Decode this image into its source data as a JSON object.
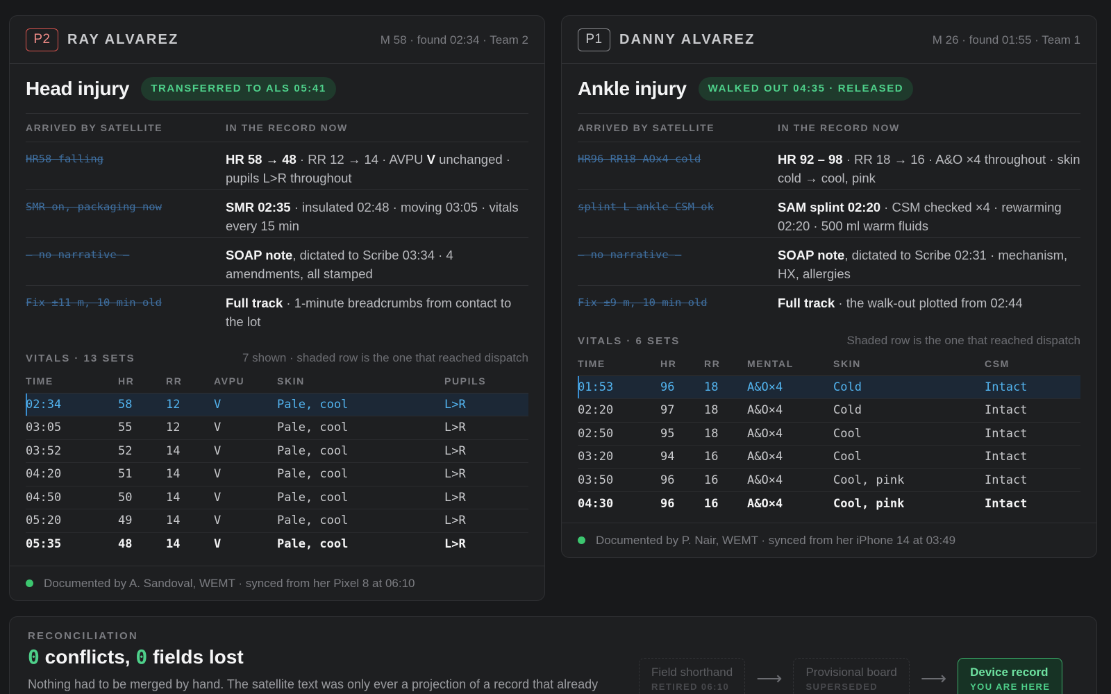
{
  "cards": [
    {
      "priority": "P2",
      "name": "RAY ALVAREZ",
      "meta": "M 58 · found 02:34 · Team 2",
      "injury": "Head injury",
      "status": "TRANSFERRED TO ALS 05:41",
      "col_left": "ARRIVED BY SATELLITE",
      "col_right": "IN THE RECORD NOW",
      "records": [
        {
          "sat": "HR58 falling",
          "html": "<b>HR 58 → 48</b> · RR 12 → 14 · AVPU <b>V</b> unchanged · pupils L&gt;R throughout"
        },
        {
          "sat": "SMR on, packaging now",
          "html": "<b>SMR 02:35</b> · insulated 02:48 · moving 03:05 · vitals every 15 min"
        },
        {
          "sat": "— no narrative —",
          "html": "<b>SOAP note</b>, dictated to Scribe 03:34 · 4 amendments, all stamped"
        },
        {
          "sat": "Fix ±11 m, 10 min old",
          "html": "<b>Full track</b> · 1-minute breadcrumbs from contact to the lot"
        }
      ],
      "vitals_title": "VITALS · 13 SETS",
      "vitals_note": "7 shown · shaded row is the one that reached dispatch",
      "vitals_cols": [
        "TIME",
        "HR",
        "RR",
        "AVPU",
        "SKIN",
        "PUPILS"
      ],
      "vitals_rows": [
        [
          "02:34",
          "58",
          "12",
          "V",
          "Pale, cool",
          "L>R"
        ],
        [
          "03:05",
          "55",
          "12",
          "V",
          "Pale, cool",
          "L>R"
        ],
        [
          "03:52",
          "52",
          "14",
          "V",
          "Pale, cool",
          "L>R"
        ],
        [
          "04:20",
          "51",
          "14",
          "V",
          "Pale, cool",
          "L>R"
        ],
        [
          "04:50",
          "50",
          "14",
          "V",
          "Pale, cool",
          "L>R"
        ],
        [
          "05:20",
          "49",
          "14",
          "V",
          "Pale, cool",
          "L>R"
        ],
        [
          "05:35",
          "48",
          "14",
          "V",
          "Pale, cool",
          "L>R"
        ]
      ],
      "footer": "Documented by A. Sandoval, WEMT · synced from her Pixel 8 at 06:10"
    },
    {
      "priority": "P1",
      "name": "DANNY ALVAREZ",
      "meta": "M 26 · found 01:55 · Team 1",
      "injury": "Ankle injury",
      "status": "WALKED OUT 04:35 · RELEASED",
      "col_left": "ARRIVED BY SATELLITE",
      "col_right": "IN THE RECORD NOW",
      "records": [
        {
          "sat": "HR96 RR18 AOx4 cold",
          "html": "<b>HR 92 – 98</b> · RR 18 → 16 · A&amp;O ×4 throughout · skin cold → cool, pink"
        },
        {
          "sat": "splint L ankle CSM ok",
          "html": "<b>SAM splint 02:20</b> · CSM checked ×4 · rewarming 02:20 · 500 ml warm fluids"
        },
        {
          "sat": "— no narrative —",
          "html": "<b>SOAP note</b>, dictated to Scribe 02:31 · mechanism, HX, allergies"
        },
        {
          "sat": "Fix ±9 m, 10 min old",
          "html": "<b>Full track</b> · the walk-out plotted from 02:44"
        }
      ],
      "vitals_title": "VITALS · 6 SETS",
      "vitals_note": "Shaded row is the one that reached dispatch",
      "vitals_cols": [
        "TIME",
        "HR",
        "RR",
        "MENTAL",
        "SKIN",
        "CSM"
      ],
      "vitals_rows": [
        [
          "01:53",
          "96",
          "18",
          "A&O×4",
          "Cold",
          "Intact"
        ],
        [
          "02:20",
          "97",
          "18",
          "A&O×4",
          "Cold",
          "Intact"
        ],
        [
          "02:50",
          "95",
          "18",
          "A&O×4",
          "Cool",
          "Intact"
        ],
        [
          "03:20",
          "94",
          "16",
          "A&O×4",
          "Cool",
          "Intact"
        ],
        [
          "03:50",
          "96",
          "16",
          "A&O×4",
          "Cool, pink",
          "Intact"
        ],
        [
          "04:30",
          "96",
          "16",
          "A&O×4",
          "Cool, pink",
          "Intact"
        ]
      ],
      "footer": "Documented by P. Nair, WEMT · synced from her iPhone 14 at 03:49"
    }
  ],
  "reconciliation": {
    "label": "RECONCILIATION",
    "conflicts": "0",
    "conflicts_text": " conflicts, ",
    "fields_lost": "0",
    "fields_lost_text": " fields lost",
    "description": "Nothing had to be merged by hand. The satellite text was only ever a projection of a record that already",
    "flow": [
      {
        "title": "Field shorthand",
        "sub": "RETIRED 06:10"
      },
      {
        "title": "Provisional board",
        "sub": "SUPERSEDED"
      },
      {
        "title": "Device record",
        "sub": "YOU ARE HERE"
      }
    ],
    "arrow": "⟶"
  },
  "colors": {
    "background": "#18191b",
    "accent_green": "#4ed08a",
    "accent_blue": "#52b3ee",
    "priority_red": "#d9544f"
  }
}
